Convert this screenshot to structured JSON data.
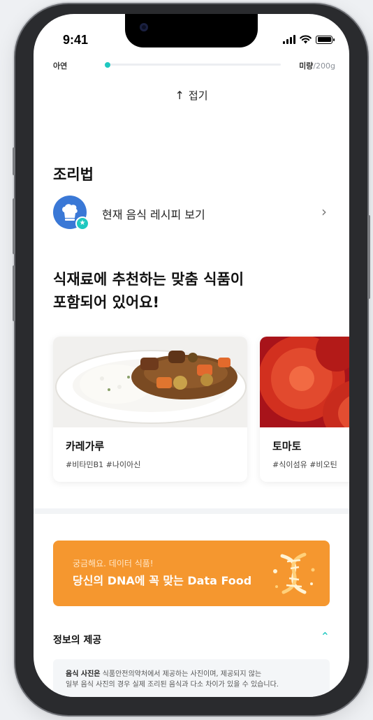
{
  "status_bar": {
    "time": "9:41"
  },
  "progress": {
    "left_label": "아연",
    "right_label": "미량",
    "right_unit": "/200g",
    "value_fraction": 0.0
  },
  "collapse": {
    "arrow": "↑",
    "label": "접기"
  },
  "recipe": {
    "section_title": "조리법",
    "item_label": "현재 음식 레시피 보기",
    "chevron": "›"
  },
  "recommend": {
    "title_line1": "식재료에 추천하는 맞춤 식품이",
    "title_line2": "포함되어 있어요!",
    "cards": [
      {
        "name": "카레가루",
        "tags": "#비타민B1  #나이아신"
      },
      {
        "name": "토마토",
        "tags": "#식이섬유  #비오틴"
      }
    ]
  },
  "banner": {
    "subtitle": "궁금해요. 데이터 식품!",
    "title": "당신의 DNA에 꼭 맞는 Data Food",
    "color": "#f5972f"
  },
  "info": {
    "title": "정보의 제공",
    "chevron": "⌃",
    "text_bold": "음식 사진은",
    "text_source": " 식품안전의약처에서 제공하는 사진이며, 제공되지 않는",
    "text_line2": "일부 음식 사진의 경우 실제 조리된 음식과 다소 차이가 있을 수 있습니다."
  },
  "colors": {
    "accent": "#1fc8c0",
    "primary_blue": "#3a78d6"
  }
}
